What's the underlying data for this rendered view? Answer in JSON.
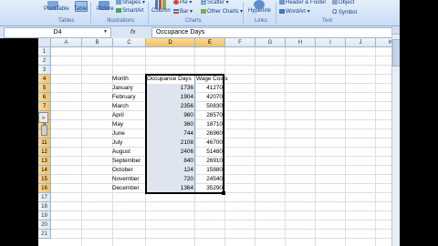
{
  "ribbon": {
    "tables_group": {
      "label": "Tables",
      "pivot_table": "PivotTable",
      "table": "Table"
    },
    "illustrations_group": {
      "label": "Illustrations",
      "picture": "Picture",
      "shapes": "Shapes",
      "smartart": "SmartArt"
    },
    "charts_group": {
      "label": "Charts",
      "column": "Column",
      "pie": "Pie",
      "bar": "Bar",
      "scatter": "Scatter",
      "other_charts": "Other Charts"
    },
    "links_group": {
      "label": "Links",
      "hyperlink": "Hyperlink"
    },
    "text_group": {
      "label": "Text",
      "header_footer": "Header & Footer",
      "wordart": "WordArt",
      "object": "Object",
      "symbol": "Symbol"
    }
  },
  "formula_bar": {
    "name_box": "D4",
    "fx": "fx",
    "content": "Occupance Days"
  },
  "columns": [
    "A",
    "B",
    "C",
    "D",
    "E",
    "F",
    "G",
    "H",
    "I",
    "J",
    "K"
  ],
  "rows": [
    "1",
    "2",
    "3",
    "4",
    "5",
    "6",
    "7",
    "8",
    "9",
    "10",
    "11",
    "12",
    "13",
    "14",
    "15",
    "16",
    "17",
    "18",
    "19",
    "20",
    "21"
  ],
  "table": {
    "headers": {
      "month": "Month",
      "occupance": "Occupance Days",
      "wage": "Wage Costs"
    },
    "rows": [
      {
        "month": "January",
        "days": "1736",
        "wage": "41270"
      },
      {
        "month": "February",
        "days": "1904",
        "wage": "42070"
      },
      {
        "month": "March",
        "days": "2356",
        "wage": "50830"
      },
      {
        "month": "April",
        "days": "960",
        "wage": "28570"
      },
      {
        "month": "May",
        "days": "360",
        "wage": "18710"
      },
      {
        "month": "June",
        "days": "744",
        "wage": "26960"
      },
      {
        "month": "July",
        "days": "2108",
        "wage": "46700"
      },
      {
        "month": "August",
        "days": "2406",
        "wage": "51480"
      },
      {
        "month": "September",
        "days": "840",
        "wage": "26910"
      },
      {
        "month": "October",
        "days": "124",
        "wage": "15880"
      },
      {
        "month": "November",
        "days": "720",
        "wage": "24540"
      },
      {
        "month": "December",
        "days": "1364",
        "wage": "35290"
      }
    ]
  },
  "colors": {
    "selection_fill": "#dfe5ef",
    "header_selected": "#f1c15f",
    "ribbon": "#c9dcf3"
  }
}
